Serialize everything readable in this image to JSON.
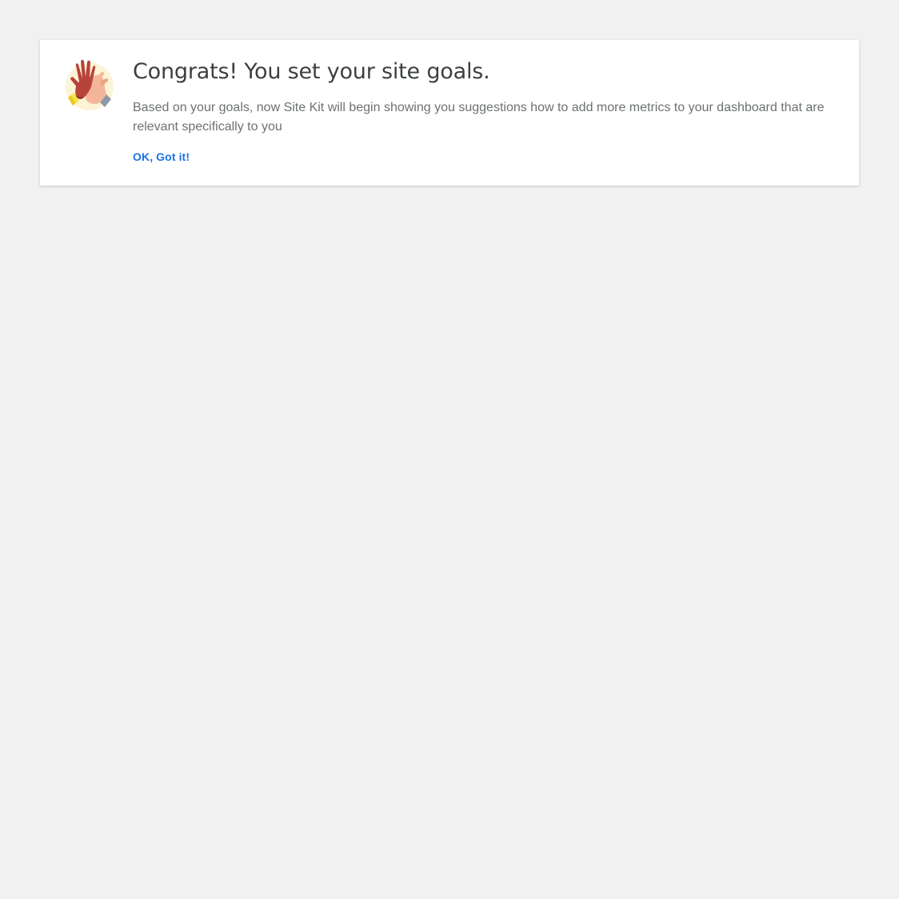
{
  "notice": {
    "graphic_icon": "high-five-icon",
    "title": "Congrats! You set your site goals.",
    "description": "Based on your goals, now Site Kit will begin showing you suggestions how to add more metrics to your dashboard that are relevant specifically to you",
    "cta_label": "OK, Got it!"
  },
  "colors": {
    "page_background": "#f1f1f1",
    "card_background": "#ffffff",
    "title_text": "#3c4043",
    "body_text": "#6c726e",
    "link": "#1a73e8"
  }
}
